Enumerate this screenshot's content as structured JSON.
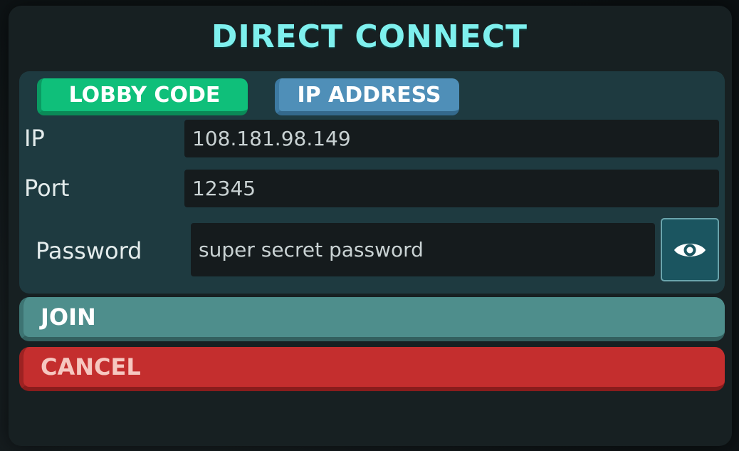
{
  "dialog": {
    "title": "DIRECT CONNECT"
  },
  "tabs": [
    {
      "label": "LOBBY CODE",
      "color": "#0fbf7a"
    },
    {
      "label": "IP ADDRESS",
      "color": "#4f8fb8"
    }
  ],
  "form": {
    "ip_label": "IP",
    "ip_value": "108.181.98.149",
    "port_label": "Port",
    "port_value": "12345",
    "password_label": "Password",
    "password_value": "super secret password",
    "reveal_icon": "eye-icon"
  },
  "actions": {
    "join_label": "JOIN",
    "cancel_label": "CANCEL"
  },
  "colors": {
    "title": "#7ef0ee",
    "join": "#4e8e8c",
    "cancel": "#c42e2e"
  }
}
